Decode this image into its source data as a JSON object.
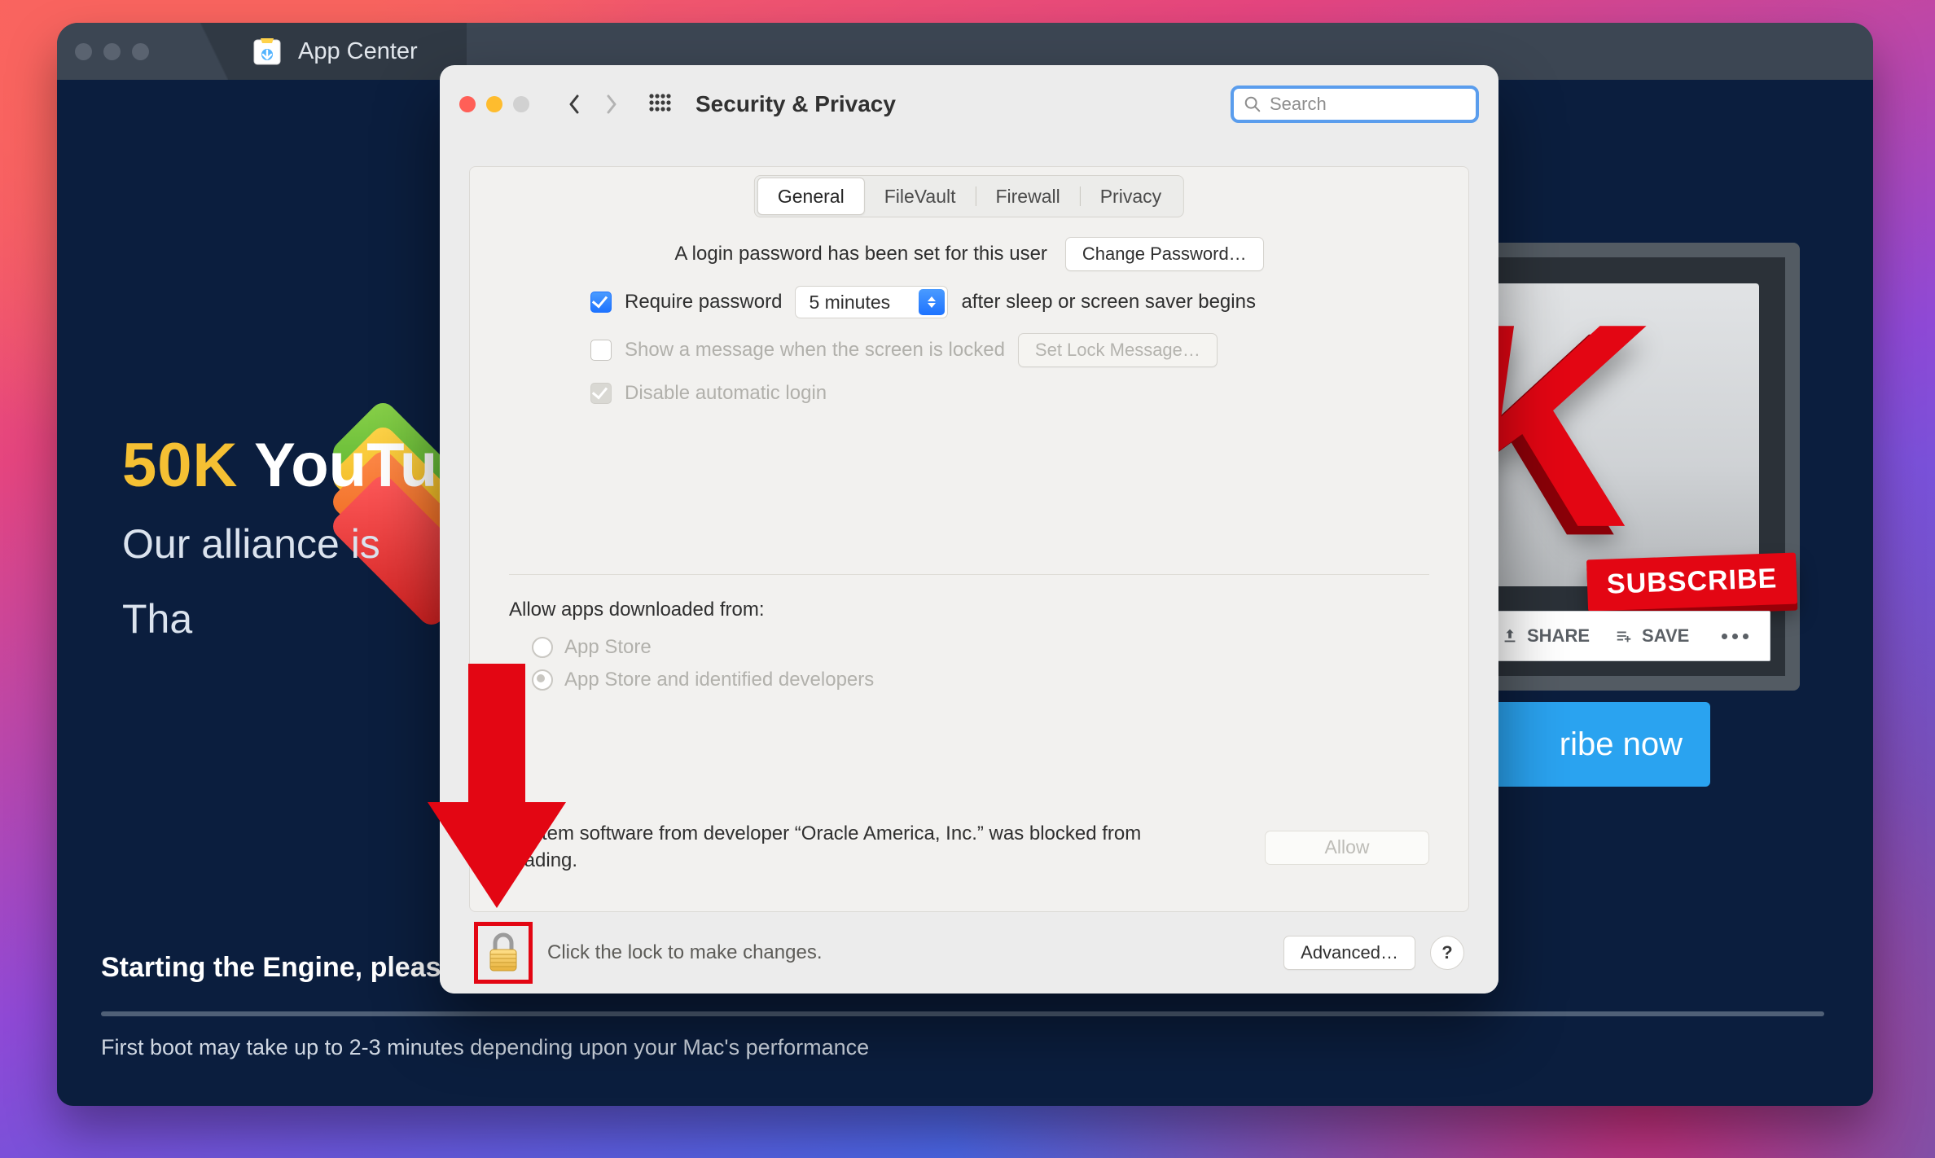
{
  "appcenter": {
    "tab_title": "App Center",
    "promo": {
      "gold": "50K",
      "rest": " YouTu",
      "line2": "Our alliance is",
      "line3": "Tha"
    },
    "subscribe_badge": "SUBSCRIBE",
    "toolbar": {
      "share": "SHARE",
      "save": "SAVE"
    },
    "cta": "ribe now",
    "status_line1": "Starting the Engine, please wait",
    "status_line2": "First boot may take up to 2-3 minutes depending upon your Mac's performance"
  },
  "prefs": {
    "title": "Security & Privacy",
    "search_placeholder": "Search",
    "tabs": {
      "general": "General",
      "filevault": "FileVault",
      "firewall": "Firewall",
      "privacy": "Privacy"
    },
    "row1_text": "A login password has been set for this user",
    "change_password": "Change Password…",
    "require_password_label": "Require password",
    "require_password_select": "5 minutes",
    "require_password_after": "after sleep or screen saver begins",
    "show_message_label": "Show a message when the screen is locked",
    "set_lock_message": "Set Lock Message…",
    "disable_auto_login": "Disable automatic login",
    "allow_title": "Allow apps downloaded from:",
    "allow_opt1": "App Store",
    "allow_opt2": "App Store and identified developers",
    "blocked_text": "System software from developer “Oracle America, Inc.” was blocked from loading.",
    "allow_button": "Allow",
    "lock_hint": "Click the lock to make changes.",
    "advanced": "Advanced…",
    "help": "?"
  }
}
